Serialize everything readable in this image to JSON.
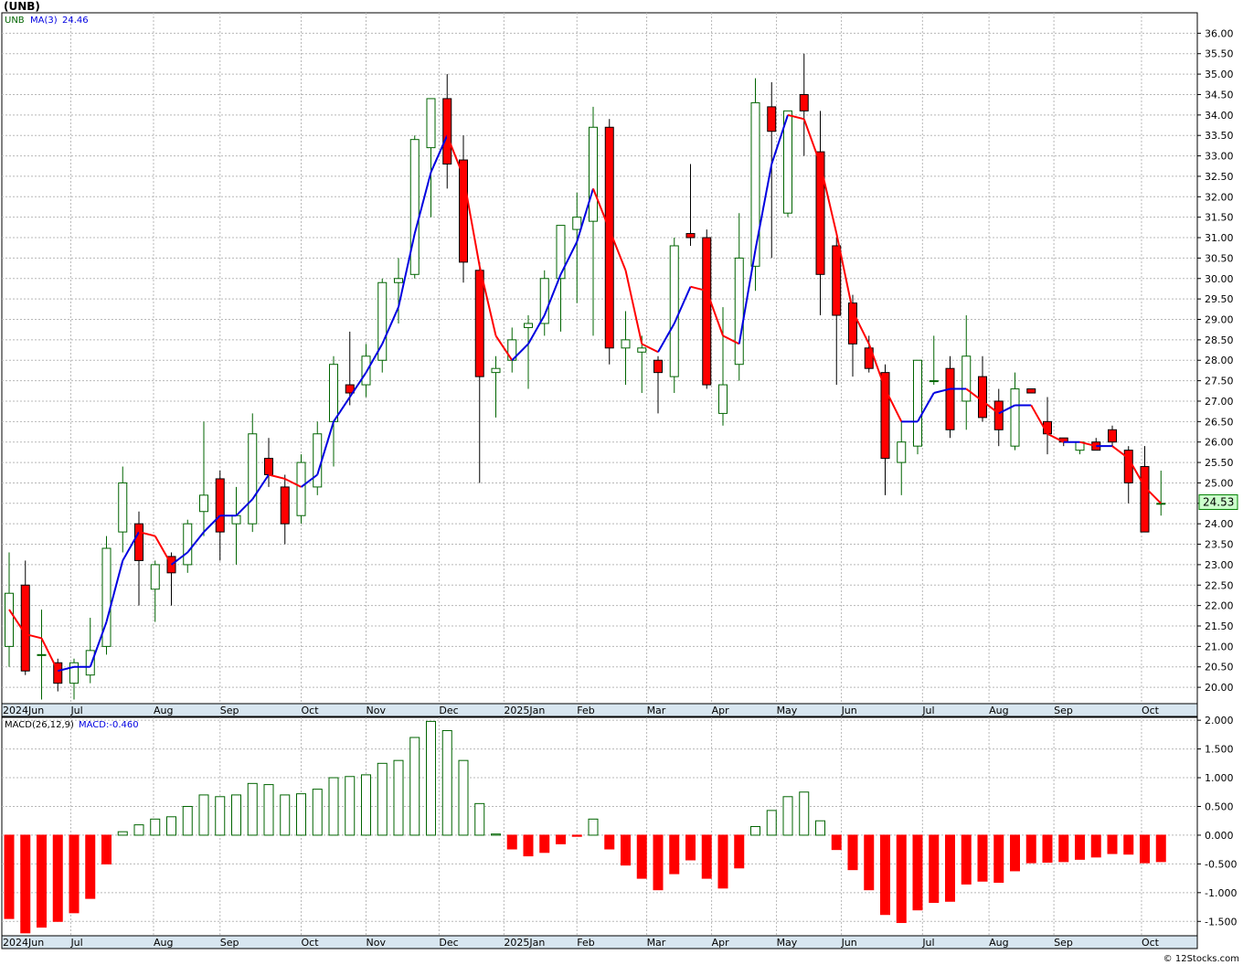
{
  "title": "(UNB)",
  "footer": "© 12Stocks.com",
  "last_price": "24.53",
  "colors": {
    "up": "#006400",
    "down": "#ff0000",
    "ma_up": "#0000e0",
    "ma_down": "#ff0000",
    "grid": "#b8b8b8",
    "axis_band": "#d8e6f0",
    "price_tag": "#ccffcc"
  },
  "chart_data": [
    {
      "type": "candlestick",
      "name": "price",
      "legend": {
        "symbol": "UNB",
        "ma_label": "MA(3)",
        "ma_value": "24.46"
      },
      "ylim": [
        19.6,
        36.5
      ],
      "y_ticks": [
        "20.00",
        "20.50",
        "21.00",
        "21.50",
        "22.00",
        "22.50",
        "23.00",
        "23.50",
        "24.00",
        "24.50",
        "25.00",
        "25.50",
        "26.00",
        "26.50",
        "27.00",
        "27.50",
        "28.00",
        "28.50",
        "29.00",
        "29.50",
        "30.00",
        "30.50",
        "31.00",
        "31.50",
        "32.00",
        "32.50",
        "33.00",
        "33.50",
        "34.00",
        "34.50",
        "35.00",
        "35.50",
        "36.00"
      ],
      "x_labels": [
        "2024Jun",
        "Jul",
        "Aug",
        "Sep",
        "Oct",
        "Nov",
        "Dec",
        "2025Jan",
        "Feb",
        "Mar",
        "Apr",
        "May",
        "Jun",
        "Jul",
        "Aug",
        "Sep",
        "Oct"
      ],
      "ohlc": [
        [
          21.0,
          23.3,
          20.5,
          22.3
        ],
        [
          22.5,
          23.1,
          20.3,
          20.4
        ],
        [
          20.8,
          21.9,
          19.7,
          20.8
        ],
        [
          20.6,
          20.7,
          19.9,
          20.1
        ],
        [
          20.1,
          20.7,
          19.7,
          20.6
        ],
        [
          20.3,
          21.7,
          20.1,
          20.9
        ],
        [
          21.0,
          23.7,
          20.8,
          23.4
        ],
        [
          23.8,
          25.4,
          23.3,
          25.0
        ],
        [
          24.0,
          24.3,
          22.0,
          23.1
        ],
        [
          22.4,
          23.1,
          21.6,
          23.0
        ],
        [
          23.2,
          23.3,
          22.0,
          22.8
        ],
        [
          23.0,
          24.1,
          22.8,
          24.0
        ],
        [
          24.3,
          26.5,
          23.7,
          24.7
        ],
        [
          25.1,
          25.3,
          23.1,
          23.8
        ],
        [
          24.0,
          24.9,
          23.0,
          24.2
        ],
        [
          24.0,
          26.7,
          23.8,
          26.2
        ],
        [
          25.6,
          26.1,
          24.9,
          25.2
        ],
        [
          24.9,
          25.2,
          23.5,
          24.0
        ],
        [
          24.2,
          25.7,
          24.0,
          25.5
        ],
        [
          24.9,
          26.5,
          24.7,
          26.2
        ],
        [
          26.5,
          28.1,
          25.4,
          27.9
        ],
        [
          27.4,
          28.7,
          26.9,
          27.2
        ],
        [
          27.4,
          28.4,
          27.1,
          28.1
        ],
        [
          28.0,
          30.0,
          27.7,
          29.9
        ],
        [
          29.9,
          30.5,
          28.9,
          30.0
        ],
        [
          30.1,
          33.5,
          30.0,
          33.4
        ],
        [
          33.2,
          34.3,
          31.5,
          34.4
        ],
        [
          34.4,
          35.0,
          32.2,
          32.8
        ],
        [
          32.9,
          33.5,
          29.9,
          30.4
        ],
        [
          30.2,
          30.4,
          25.0,
          27.6
        ],
        [
          27.7,
          28.1,
          26.6,
          27.8
        ],
        [
          28.0,
          28.8,
          27.7,
          28.5
        ],
        [
          28.8,
          29.1,
          27.3,
          28.9
        ],
        [
          28.9,
          30.2,
          28.6,
          30.0
        ],
        [
          30.0,
          31.3,
          28.7,
          31.3
        ],
        [
          31.2,
          32.1,
          29.4,
          31.5
        ],
        [
          31.4,
          34.2,
          28.6,
          33.7
        ],
        [
          33.7,
          33.9,
          27.9,
          28.3
        ],
        [
          28.3,
          29.2,
          27.4,
          28.5
        ],
        [
          28.2,
          28.6,
          27.2,
          28.3
        ],
        [
          28.0,
          28.1,
          26.7,
          27.7
        ],
        [
          27.6,
          31.0,
          27.2,
          30.8
        ],
        [
          31.1,
          32.8,
          30.8,
          31.0
        ],
        [
          31.0,
          31.2,
          27.3,
          27.4
        ],
        [
          26.7,
          29.3,
          26.4,
          27.4
        ],
        [
          27.9,
          31.6,
          27.5,
          30.5
        ],
        [
          30.3,
          34.9,
          29.7,
          34.3
        ],
        [
          34.2,
          34.8,
          30.5,
          33.6
        ],
        [
          31.6,
          34.1,
          31.5,
          34.1
        ],
        [
          34.5,
          35.5,
          33.0,
          34.1
        ],
        [
          33.1,
          34.1,
          29.1,
          30.1
        ],
        [
          30.8,
          31.0,
          27.4,
          29.1
        ],
        [
          29.4,
          29.6,
          27.6,
          28.4
        ],
        [
          28.3,
          28.6,
          27.7,
          27.8
        ],
        [
          27.7,
          27.9,
          24.7,
          25.6
        ],
        [
          25.5,
          26.5,
          24.7,
          26.0
        ],
        [
          25.9,
          28.0,
          25.7,
          28.0
        ],
        [
          27.5,
          28.6,
          27.4,
          27.5
        ],
        [
          27.8,
          28.1,
          26.1,
          26.3
        ],
        [
          27.0,
          29.1,
          26.3,
          28.1
        ],
        [
          27.6,
          28.1,
          26.5,
          26.6
        ],
        [
          27.0,
          27.3,
          25.9,
          26.3
        ],
        [
          25.9,
          27.7,
          25.8,
          27.3
        ],
        [
          27.3,
          27.3,
          27.2,
          27.2
        ],
        [
          26.5,
          27.1,
          25.7,
          26.2
        ],
        [
          26.1,
          26.1,
          25.9,
          26.0
        ],
        [
          25.8,
          26.0,
          25.7,
          26.0
        ],
        [
          26.0,
          26.1,
          25.8,
          25.8
        ],
        [
          26.3,
          26.4,
          25.9,
          26.0
        ],
        [
          25.8,
          25.9,
          24.5,
          25.0
        ],
        [
          25.4,
          25.9,
          23.8,
          23.8
        ],
        [
          24.5,
          25.3,
          24.2,
          24.5
        ]
      ],
      "ma3": [
        21.9,
        21.3,
        21.2,
        20.4,
        20.5,
        20.5,
        21.6,
        23.1,
        23.8,
        23.7,
        23.0,
        23.3,
        23.8,
        24.2,
        24.2,
        24.6,
        25.2,
        25.1,
        24.9,
        25.2,
        26.5,
        27.1,
        27.7,
        28.4,
        29.3,
        31.1,
        32.6,
        33.5,
        32.5,
        30.3,
        28.6,
        28.0,
        28.4,
        29.1,
        30.1,
        30.9,
        32.2,
        31.2,
        30.2,
        28.4,
        28.2,
        28.9,
        29.8,
        29.7,
        28.6,
        28.4,
        30.7,
        32.8,
        34.0,
        33.9,
        32.8,
        31.1,
        29.2,
        28.4,
        27.3,
        26.5,
        26.5,
        27.2,
        27.3,
        27.3,
        27.0,
        26.7,
        26.9,
        26.9,
        26.2,
        26.0,
        26.0,
        25.9,
        25.9,
        25.6,
        24.9,
        24.5
      ]
    },
    {
      "type": "bar",
      "name": "macd",
      "legend": {
        "label": "MACD(26,12,9)",
        "value": "MACD:-0.460"
      },
      "ylim": [
        -1.75,
        2.05
      ],
      "y_ticks": [
        "2.000",
        "1.500",
        "1.000",
        "0.500",
        "0.000",
        "-0.500",
        "-1.000",
        "-1.500"
      ],
      "x_labels": [
        "2024Jun",
        "Jul",
        "Aug",
        "Sep",
        "Oct",
        "Nov",
        "Dec",
        "2025Jan",
        "Feb",
        "Mar",
        "Apr",
        "May",
        "Jun",
        "Jul",
        "Aug",
        "Sep",
        "Oct"
      ],
      "values": [
        -1.45,
        -1.7,
        -1.6,
        -1.5,
        -1.35,
        -1.1,
        -0.5,
        0.06,
        0.18,
        0.28,
        0.32,
        0.5,
        0.7,
        0.67,
        0.7,
        0.9,
        0.88,
        0.7,
        0.72,
        0.8,
        1.0,
        1.02,
        1.05,
        1.25,
        1.3,
        1.7,
        1.98,
        1.82,
        1.3,
        0.55,
        0.02,
        -0.24,
        -0.36,
        -0.3,
        -0.15,
        -0.02,
        0.28,
        -0.24,
        -0.52,
        -0.75,
        -0.95,
        -0.67,
        -0.43,
        -0.75,
        -0.92,
        -0.57,
        0.15,
        0.43,
        0.67,
        0.75,
        0.25,
        -0.25,
        -0.6,
        -0.95,
        -1.38,
        -1.52,
        -1.3,
        -1.17,
        -1.15,
        -0.85,
        -0.8,
        -0.82,
        -0.62,
        -0.48,
        -0.47,
        -0.46,
        -0.42,
        -0.38,
        -0.32,
        -0.33,
        -0.48,
        -0.46
      ]
    }
  ]
}
